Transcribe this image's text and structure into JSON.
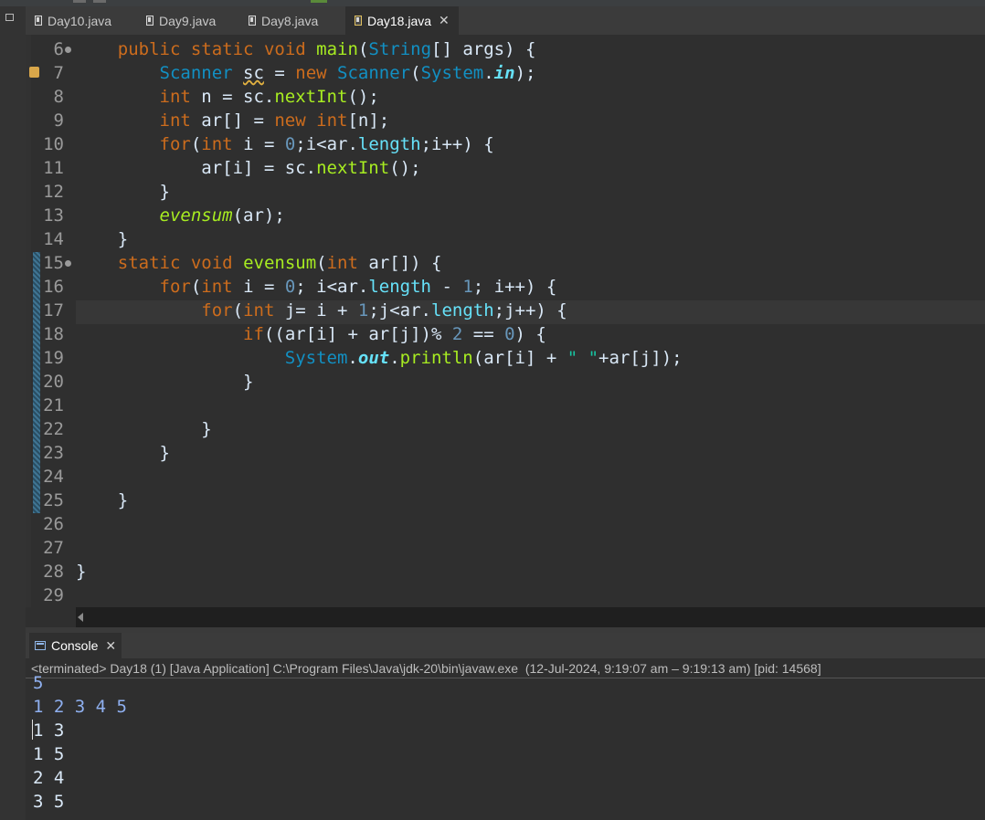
{
  "tabs": [
    {
      "label": "Day10.java",
      "active": false
    },
    {
      "label": "Day9.java",
      "active": false
    },
    {
      "label": "Day8.java",
      "active": false
    },
    {
      "label": "Day18.java",
      "active": true
    }
  ],
  "line_numbers": [
    "6",
    "7",
    "8",
    "9",
    "10",
    "11",
    "12",
    "13",
    "14",
    "15",
    "16",
    "17",
    "18",
    "19",
    "20",
    "21",
    "22",
    "23",
    "24",
    "25",
    "26",
    "27",
    "28",
    "29"
  ],
  "console": {
    "tab_label": "Console",
    "terminated": "<terminated> Day18 (1) [Java Application] C:\\Program Files\\Java\\jdk-20\\bin\\javaw.exe  (12-Jul-2024, 9:19:07 am – 9:19:13 am) [pid: 14568]",
    "output": [
      "5",
      "1 2 3 4 5",
      "1 3",
      "1 5",
      "2 4",
      "3 5"
    ]
  },
  "colors": {
    "keyword": "#cc6c1d",
    "type": "#1290c3",
    "method": "#a7ec21",
    "number": "#6897bb",
    "field": "#66e1f8",
    "background": "#2f2f2f"
  }
}
